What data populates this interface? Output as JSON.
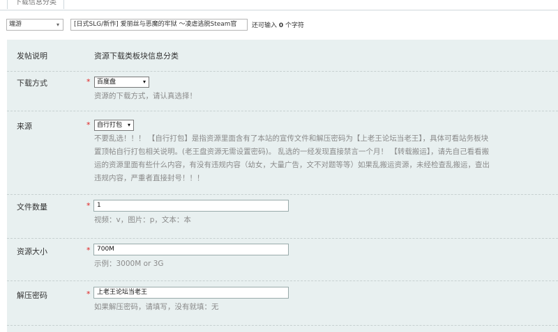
{
  "tab": {
    "label": "下载信息分类"
  },
  "title_row": {
    "type_select_value": "端游",
    "title_value": "[日式SLG/新作] 爱丽丝与恶魔的牢狱 ～凌虐逃脱Steam官",
    "remain_prefix": "还可输入",
    "remain_count": "0",
    "remain_suffix": "个字符"
  },
  "form": {
    "header": {
      "label": "发帖说明",
      "value": "资源下载类板块信息分类"
    },
    "download_method": {
      "label": "下载方式",
      "required": "*",
      "selected": "百度盘",
      "hint": "资源的下载方式，请认真选择！"
    },
    "source": {
      "label": "来源",
      "required": "*",
      "selected": "自行打包",
      "hint_lines": [
        "不要乱选！！！ 【自行打包】是指资源里面含有了本站的宣传文件和解压密码为【上老王论坛当老王】，具体可看站务板块",
        "置顶帖自行打包相关说明。(老王盘资源无需设置密码)。 乱选的一经发现直接禁言一个月！ 【转载搬运】，请先自己看看搬",
        "运的资源里面有些什么内容，有没有违规内容（幼女，大量广告，文不对题等等）如果乱搬运资源，未经检查乱搬运，查出",
        "违规内容，严重者直接封号！！！"
      ]
    },
    "file_count": {
      "label": "文件数量",
      "required": "*",
      "value": "1",
      "hint": "视频：v，图片：p，文本：本"
    },
    "resource_size": {
      "label": "资源大小",
      "required": "*",
      "value": "700M",
      "hint": "示例：3000M or 3G"
    },
    "unzip_password": {
      "label": "解压密码",
      "required": "*",
      "value": "上老王论坛当老王",
      "hint": "如果解压密码，请填写，没有就填：无"
    }
  }
}
